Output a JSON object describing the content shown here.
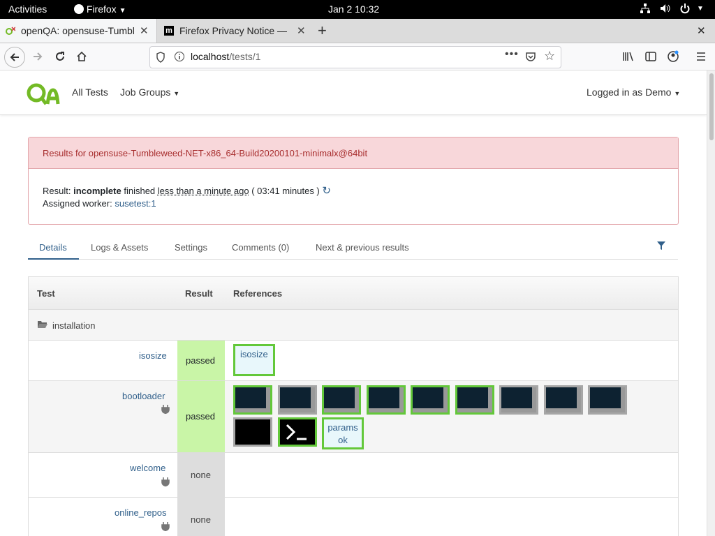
{
  "gnome": {
    "activities": "Activities",
    "app": "Firefox",
    "clock": "Jan 2  10:32"
  },
  "tabs": [
    {
      "label": "openQA: opensuse-Tumbl",
      "active": true
    },
    {
      "label": "Firefox Privacy Notice —",
      "active": false
    }
  ],
  "nav": {
    "url_host": "localhost",
    "url_path": "/tests/1"
  },
  "header": {
    "all_tests": "All Tests",
    "job_groups": "Job Groups",
    "logged_in": "Logged in as Demo"
  },
  "alert": {
    "title": "Results for opensuse-Tumbleweed-NET-x86_64-Build20200101-minimalx@64bit",
    "result_label": "Result:",
    "result_value": "incomplete",
    "finished": "finished",
    "time_ago": "less than a minute ago",
    "duration": "( 03:41 minutes )",
    "worker_label": "Assigned worker:",
    "worker": "susetest:1"
  },
  "page_tabs": [
    "Details",
    "Logs & Assets",
    "Settings",
    "Comments (0)",
    "Next & previous results"
  ],
  "table": {
    "headers": {
      "test": "Test",
      "result": "Result",
      "references": "References"
    },
    "group": "installation",
    "rows": [
      {
        "name": "isosize",
        "result": "passed",
        "ref_text": "isosize"
      },
      {
        "name": "bootloader",
        "result": "passed",
        "ref_text": "params ok"
      },
      {
        "name": "welcome",
        "result": "none"
      },
      {
        "name": "online_repos",
        "result": "none"
      }
    ]
  },
  "colors": {
    "passed_bg": "#c9f5a7",
    "none_bg": "#dddddd",
    "alert_bg": "#f8d7da",
    "alert_text": "#a72d2d",
    "link": "#305f8a",
    "ok_border": "#63c83a"
  }
}
